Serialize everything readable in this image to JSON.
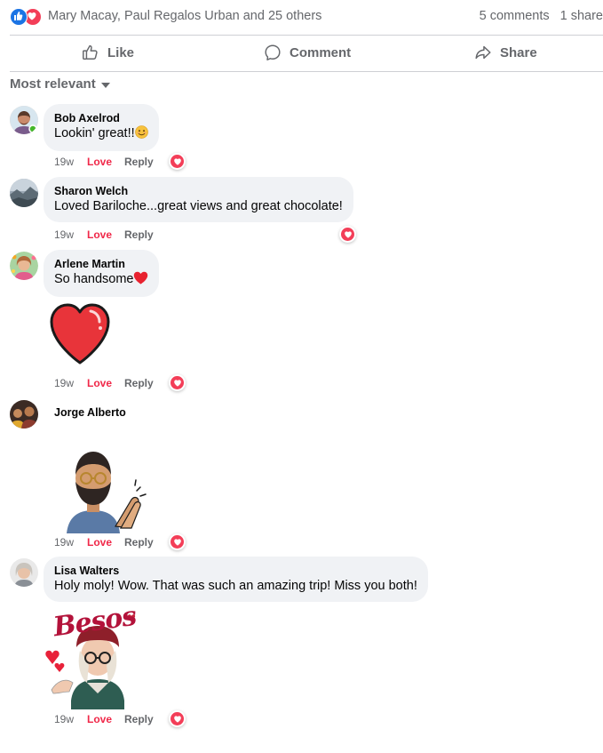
{
  "reactions": {
    "names": "Mary Macay, Paul Regalos Urban and 25 others",
    "comments": "5 comments",
    "shares": "1 share",
    "colors": {
      "like": "#1b74e4",
      "love": "#f33e58"
    }
  },
  "actions": {
    "like": "Like",
    "comment": "Comment",
    "share": "Share"
  },
  "sort": {
    "label": "Most relevant"
  },
  "comments": [
    {
      "name": "Bob Axelrod",
      "text": "Lookin' great!!",
      "emoji": "smiling-face-icon",
      "time": "19w",
      "love": "Love",
      "reply": "Reply"
    },
    {
      "name": "Sharon Welch",
      "text": "Loved Bariloche...great views and great chocolate!",
      "time": "19w",
      "love": "Love",
      "reply": "Reply"
    },
    {
      "name": "Arlene Martin",
      "text": "So handsome",
      "emoji": "red-heart-icon",
      "sticker": "heart-sticker",
      "time": "19w",
      "love": "Love",
      "reply": "Reply"
    },
    {
      "name": "Jorge Alberto",
      "sticker": "clapping-avatar-sticker",
      "time": "19w",
      "love": "Love",
      "reply": "Reply"
    },
    {
      "name": "Lisa Walters",
      "text": "Holy moly! Wow. That was such an amazing trip! Miss you both!",
      "sticker": "besos-avatar-sticker",
      "sticker_text": "Besos",
      "time": "19w",
      "love": "Love",
      "reply": "Reply"
    }
  ]
}
